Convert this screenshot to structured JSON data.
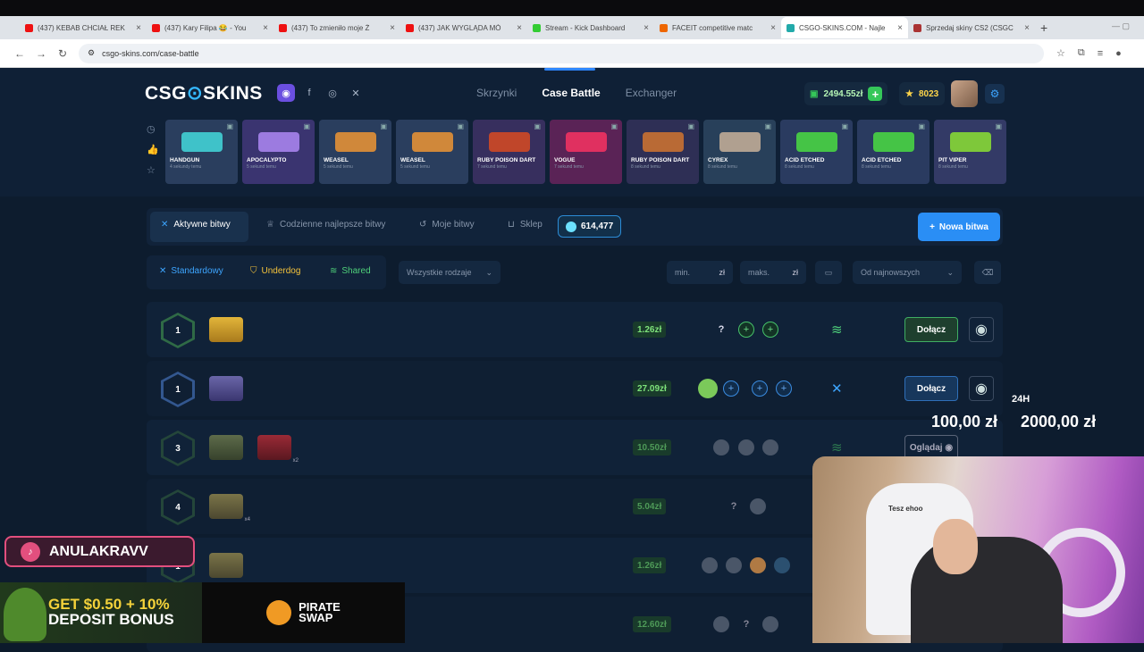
{
  "browser": {
    "tabs": [
      {
        "title": "(437) KEBAB CHCIAŁ REK",
        "color": "#e11"
      },
      {
        "title": "(437) Kary Filipa 😂 - You",
        "color": "#e11"
      },
      {
        "title": "(437) To zmieniło moje Ż",
        "color": "#e11"
      },
      {
        "title": "(437) JAK WYGLĄDA MÓ",
        "color": "#e11"
      },
      {
        "title": "Stream - Kick Dashboard",
        "color": "#3c3"
      },
      {
        "title": "FACEIT competitive matc",
        "color": "#e60"
      },
      {
        "title": "CSGO-SKINS.COM - Najle",
        "color": "#2aa"
      },
      {
        "title": "Sprzedaj skiny CS2 (CSGC",
        "color": "#a33"
      }
    ],
    "url": "csgo-skins.com/case-battle"
  },
  "header": {
    "logo_a": "CSG",
    "logo_b": "SKINS",
    "nav": [
      "Skrzynki",
      "Case Battle",
      "Exchanger"
    ],
    "balance": "2494.55zł",
    "coins": "8023"
  },
  "live_drops": [
    {
      "name": "HANDGUN",
      "time": "4 sekundy temu",
      "bg": "#2a3e5e",
      "gun": "#3fc2c9"
    },
    {
      "name": "APOCALYPTO",
      "time": "5 sekund temu",
      "bg": "#3a3470",
      "gun": "#9c7be0"
    },
    {
      "name": "WEASEL",
      "time": "5 sekund temu",
      "bg": "#2a3e5e",
      "gun": "#d0883a"
    },
    {
      "name": "WEASEL",
      "time": "5 sekund temu",
      "bg": "#2a3e5e",
      "gun": "#d0883a"
    },
    {
      "name": "RUBY POISON DART",
      "time": "7 sekund temu",
      "bg": "#372f5e",
      "gun": "#c0462a"
    },
    {
      "name": "VOGUE",
      "time": "7 sekund temu",
      "bg": "#5a2356",
      "gun": "#e03060"
    },
    {
      "name": "RUBY POISON DART",
      "time": "8 sekund temu",
      "bg": "#2e2f55",
      "gun": "#b96a35"
    },
    {
      "name": "CYREX",
      "time": "8 sekund temu",
      "bg": "#28405a",
      "gun": "#b0a090"
    },
    {
      "name": "ACID ETCHED",
      "time": "8 sekund temu",
      "bg": "#2a3b60",
      "gun": "#45c446"
    },
    {
      "name": "ACID ETCHED",
      "time": "8 sekund temu",
      "bg": "#2a3b60",
      "gun": "#45c446"
    },
    {
      "name": "PIT VIPER",
      "time": "8 sekund temu",
      "bg": "#333a66",
      "gun": "#7ec83a"
    }
  ],
  "tabs": {
    "active": "Aktywne bitwy",
    "daily": "Codzienne najlepsze bitwy",
    "mine": "Moje bitwy",
    "shop": "Sklep",
    "gems": "614,477",
    "new_battle": "Nowa bitwa"
  },
  "filters": {
    "standard": "Standardowy",
    "underdog": "Underdog",
    "shared": "Shared",
    "all_types": "Wszystkie rodzaje",
    "min": "min.",
    "max": "maks.",
    "currency": "zł",
    "sort": "Od najnowszych"
  },
  "battles": [
    {
      "rounds": "1",
      "price": "1.26zł",
      "join": "Dołącz"
    },
    {
      "rounds": "1",
      "price": "27.09zł",
      "join": "Dołącz"
    },
    {
      "rounds": "3",
      "price": "10.50zł",
      "join": "Oglądaj",
      "mult": "x2"
    },
    {
      "rounds": "4",
      "price": "5.04zł",
      "mult": "x4"
    },
    {
      "rounds": "1",
      "price": "1.26zł"
    },
    {
      "price": "12.60zł"
    }
  ],
  "overlay": {
    "period": "24H",
    "amount_a": "100,00 zł",
    "amount_b": "2000,00 zł",
    "tiktok": "ANULAKRAVV",
    "chair_text": "Tesz ehoo",
    "ad1_a": "GET $0.50 + 10%",
    "ad1_b": "DEPOSIT BONUS",
    "ad2_a": "PIRATE",
    "ad2_b": "SWAP"
  }
}
